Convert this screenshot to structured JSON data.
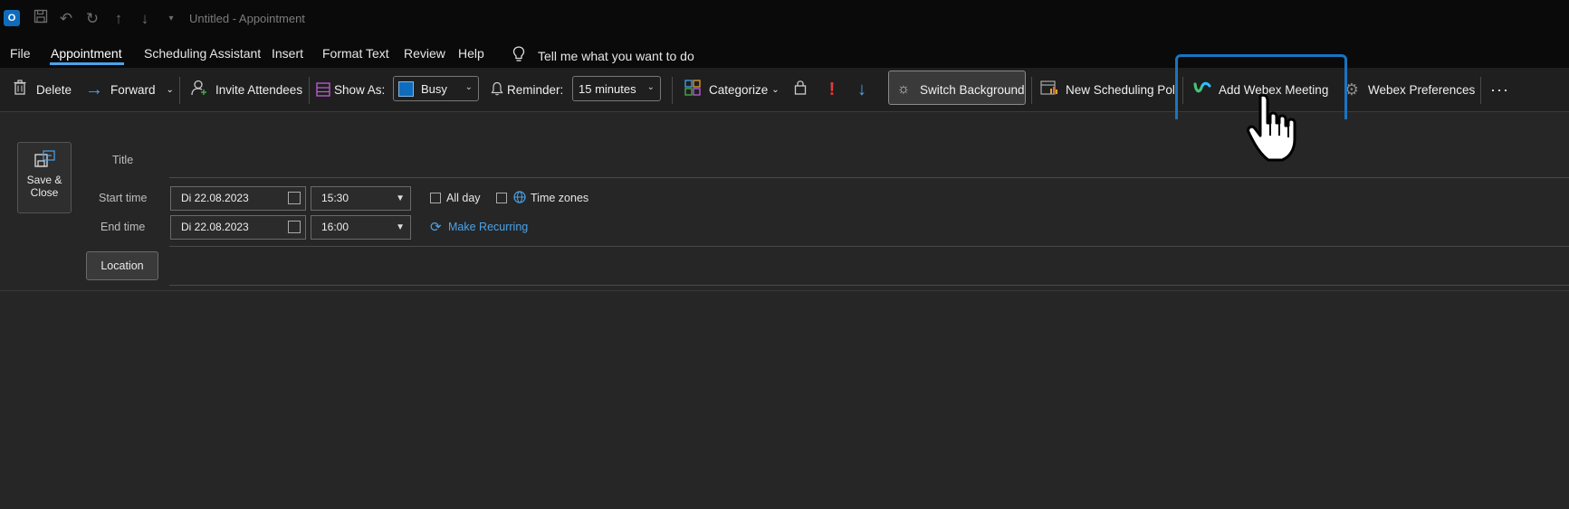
{
  "titlebar": {
    "title": "Untitled  -  Appointment",
    "icons": [
      "save-icon",
      "undo-icon",
      "redo-icon",
      "up-arrow-icon",
      "down-arrow-icon",
      "customize-icon"
    ]
  },
  "menu": {
    "items": [
      "File",
      "Appointment",
      "Scheduling Assistant",
      "Insert",
      "Format Text",
      "Review",
      "Help"
    ],
    "active": "Appointment",
    "tell_me": "Tell me what you want to do"
  },
  "ribbon": {
    "delete": "Delete",
    "forward": "Forward",
    "invite": "Invite Attendees",
    "show_as_label": "Show As:",
    "show_as_value": "Busy",
    "reminder_label": "Reminder:",
    "reminder_value": "15 minutes",
    "categorize": "Categorize",
    "switch_background": "Switch Background",
    "new_poll": "New Scheduling Poll",
    "add_webex": "Add Webex Meeting",
    "webex_prefs": "Webex Preferences",
    "more": "···",
    "colors": {
      "busy": "#0f6cbd",
      "highlight": "#1875c2",
      "importance_high": "#e03c3c",
      "importance_low": "#4aa3ea"
    }
  },
  "form": {
    "save_close": [
      "Save &",
      "Close"
    ],
    "title_label": "Title",
    "start_label": "Start time",
    "end_label": "End time",
    "start_date": "Di 22.08.2023",
    "start_time": "15:30",
    "end_date": "Di 22.08.2023",
    "end_time": "16:00",
    "all_day": "All day",
    "time_zones": "Time zones",
    "make_recurring": "Make Recurring",
    "location": "Location"
  }
}
